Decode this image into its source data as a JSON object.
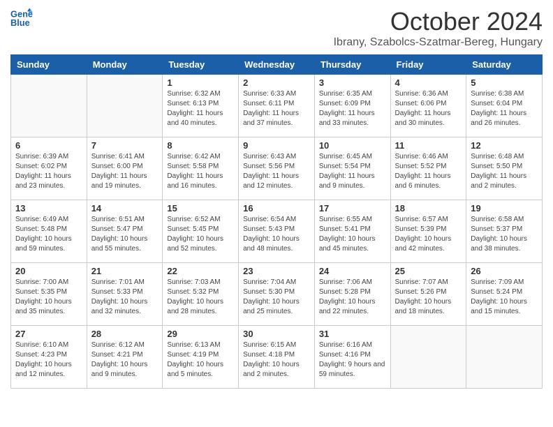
{
  "header": {
    "logo_line1": "General",
    "logo_line2": "Blue",
    "month_title": "October 2024",
    "location": "Ibrany, Szabolcs-Szatmar-Bereg, Hungary"
  },
  "weekdays": [
    "Sunday",
    "Monday",
    "Tuesday",
    "Wednesday",
    "Thursday",
    "Friday",
    "Saturday"
  ],
  "weeks": [
    [
      {
        "day": "",
        "info": ""
      },
      {
        "day": "",
        "info": ""
      },
      {
        "day": "1",
        "info": "Sunrise: 6:32 AM\nSunset: 6:13 PM\nDaylight: 11 hours and 40 minutes."
      },
      {
        "day": "2",
        "info": "Sunrise: 6:33 AM\nSunset: 6:11 PM\nDaylight: 11 hours and 37 minutes."
      },
      {
        "day": "3",
        "info": "Sunrise: 6:35 AM\nSunset: 6:09 PM\nDaylight: 11 hours and 33 minutes."
      },
      {
        "day": "4",
        "info": "Sunrise: 6:36 AM\nSunset: 6:06 PM\nDaylight: 11 hours and 30 minutes."
      },
      {
        "day": "5",
        "info": "Sunrise: 6:38 AM\nSunset: 6:04 PM\nDaylight: 11 hours and 26 minutes."
      }
    ],
    [
      {
        "day": "6",
        "info": "Sunrise: 6:39 AM\nSunset: 6:02 PM\nDaylight: 11 hours and 23 minutes."
      },
      {
        "day": "7",
        "info": "Sunrise: 6:41 AM\nSunset: 6:00 PM\nDaylight: 11 hours and 19 minutes."
      },
      {
        "day": "8",
        "info": "Sunrise: 6:42 AM\nSunset: 5:58 PM\nDaylight: 11 hours and 16 minutes."
      },
      {
        "day": "9",
        "info": "Sunrise: 6:43 AM\nSunset: 5:56 PM\nDaylight: 11 hours and 12 minutes."
      },
      {
        "day": "10",
        "info": "Sunrise: 6:45 AM\nSunset: 5:54 PM\nDaylight: 11 hours and 9 minutes."
      },
      {
        "day": "11",
        "info": "Sunrise: 6:46 AM\nSunset: 5:52 PM\nDaylight: 11 hours and 6 minutes."
      },
      {
        "day": "12",
        "info": "Sunrise: 6:48 AM\nSunset: 5:50 PM\nDaylight: 11 hours and 2 minutes."
      }
    ],
    [
      {
        "day": "13",
        "info": "Sunrise: 6:49 AM\nSunset: 5:48 PM\nDaylight: 10 hours and 59 minutes."
      },
      {
        "day": "14",
        "info": "Sunrise: 6:51 AM\nSunset: 5:47 PM\nDaylight: 10 hours and 55 minutes."
      },
      {
        "day": "15",
        "info": "Sunrise: 6:52 AM\nSunset: 5:45 PM\nDaylight: 10 hours and 52 minutes."
      },
      {
        "day": "16",
        "info": "Sunrise: 6:54 AM\nSunset: 5:43 PM\nDaylight: 10 hours and 48 minutes."
      },
      {
        "day": "17",
        "info": "Sunrise: 6:55 AM\nSunset: 5:41 PM\nDaylight: 10 hours and 45 minutes."
      },
      {
        "day": "18",
        "info": "Sunrise: 6:57 AM\nSunset: 5:39 PM\nDaylight: 10 hours and 42 minutes."
      },
      {
        "day": "19",
        "info": "Sunrise: 6:58 AM\nSunset: 5:37 PM\nDaylight: 10 hours and 38 minutes."
      }
    ],
    [
      {
        "day": "20",
        "info": "Sunrise: 7:00 AM\nSunset: 5:35 PM\nDaylight: 10 hours and 35 minutes."
      },
      {
        "day": "21",
        "info": "Sunrise: 7:01 AM\nSunset: 5:33 PM\nDaylight: 10 hours and 32 minutes."
      },
      {
        "day": "22",
        "info": "Sunrise: 7:03 AM\nSunset: 5:32 PM\nDaylight: 10 hours and 28 minutes."
      },
      {
        "day": "23",
        "info": "Sunrise: 7:04 AM\nSunset: 5:30 PM\nDaylight: 10 hours and 25 minutes."
      },
      {
        "day": "24",
        "info": "Sunrise: 7:06 AM\nSunset: 5:28 PM\nDaylight: 10 hours and 22 minutes."
      },
      {
        "day": "25",
        "info": "Sunrise: 7:07 AM\nSunset: 5:26 PM\nDaylight: 10 hours and 18 minutes."
      },
      {
        "day": "26",
        "info": "Sunrise: 7:09 AM\nSunset: 5:24 PM\nDaylight: 10 hours and 15 minutes."
      }
    ],
    [
      {
        "day": "27",
        "info": "Sunrise: 6:10 AM\nSunset: 4:23 PM\nDaylight: 10 hours and 12 minutes."
      },
      {
        "day": "28",
        "info": "Sunrise: 6:12 AM\nSunset: 4:21 PM\nDaylight: 10 hours and 9 minutes."
      },
      {
        "day": "29",
        "info": "Sunrise: 6:13 AM\nSunset: 4:19 PM\nDaylight: 10 hours and 5 minutes."
      },
      {
        "day": "30",
        "info": "Sunrise: 6:15 AM\nSunset: 4:18 PM\nDaylight: 10 hours and 2 minutes."
      },
      {
        "day": "31",
        "info": "Sunrise: 6:16 AM\nSunset: 4:16 PM\nDaylight: 9 hours and 59 minutes."
      },
      {
        "day": "",
        "info": ""
      },
      {
        "day": "",
        "info": ""
      }
    ]
  ]
}
